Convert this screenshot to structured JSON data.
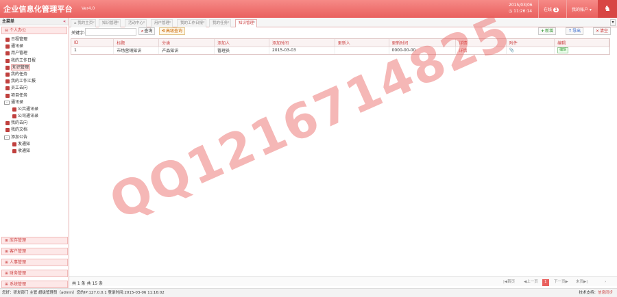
{
  "header": {
    "app_title": "企业信息化管理平台",
    "version": "Ver4.0",
    "date": "2015/03/06",
    "time": "◷ 11:26:14",
    "online_label": "在线",
    "online_count": "1",
    "account_label": "我的账户 ▾",
    "bell_icon": "bell-icon"
  },
  "sidebar": {
    "title": "主菜单",
    "collapse": "«",
    "open_section": "个人办公",
    "items": [
      "日程管理",
      "通讯录",
      "用户管理",
      "我的工作日报",
      "知识管理",
      "我的任务",
      "我的工作汇报",
      "员工去向",
      "项目任务"
    ],
    "group1": "通讯录",
    "group1_items": [
      "公共通讯录",
      "公司通讯录"
    ],
    "items2": [
      "我的去向",
      "我的文档"
    ],
    "group2": "添加公告",
    "group2_items": [
      "发通知",
      "收通知"
    ],
    "bottom_sections": [
      "库存管理",
      "客户管理",
      "人事管理",
      "财务管理",
      "系统管理"
    ]
  },
  "tabs": [
    "我的主页",
    "知识管理",
    "活动中心",
    "用户管理",
    "我的工作日报",
    "我的任务",
    "知识管理"
  ],
  "toolbar": {
    "keyword_label": "关键字:",
    "search_btn": "查询",
    "adv_btn": "高级查询",
    "add_btn": "新增",
    "export_btn": "导出",
    "delete_btn": "清空"
  },
  "grid": {
    "columns": [
      "ID",
      "标题",
      "分类",
      "添加人",
      "添加时间",
      "更新人",
      "更新时间",
      "详情",
      "附件",
      "编辑"
    ],
    "rows": [
      {
        "id": "1",
        "title": "市场营销知识",
        "category": "产品知识",
        "adder": "管理员",
        "added": "2015-03-03",
        "updater": "",
        "updated": "0000-00-00",
        "detail": "详情",
        "attach": "📎",
        "edit": "编辑"
      }
    ]
  },
  "footer": {
    "total": "共 1 条 共 15 条",
    "first": "|◀首页",
    "prev": "◀上一页",
    "page": "1",
    "next": "下一页▶",
    "last": "末页▶|",
    "goto": "›"
  },
  "status": {
    "left": "您好：研发部门 主管 超级管理员（admin）您的IP:127.0.0.1 登录时间:2015-03-06 11:16:02",
    "right_label": "技术支持：",
    "right_link": "信息同步"
  },
  "watermark": "QQ1216714825"
}
